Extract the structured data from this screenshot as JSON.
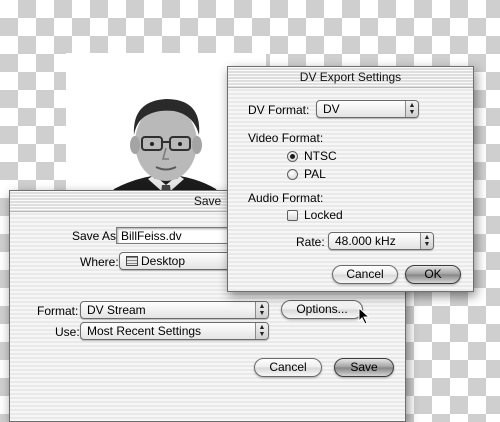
{
  "save_dialog": {
    "title": "Save",
    "save_as_label": "Save As:",
    "save_as_value": "BillFeiss.dv",
    "where_label": "Where:",
    "where_value": "Desktop",
    "where_icon": "desktop-folder-icon",
    "format_label": "Format:",
    "format_value": "DV Stream",
    "options_button": "Options...",
    "use_label": "Use:",
    "use_value": "Most Recent Settings",
    "cancel_button": "Cancel",
    "save_button": "Save"
  },
  "dv_dialog": {
    "title": "DV Export Settings",
    "dv_format_label": "DV Format:",
    "dv_format_value": "DV",
    "video_format_label": "Video Format:",
    "video_options": [
      {
        "label": "NTSC",
        "selected": true
      },
      {
        "label": "PAL",
        "selected": false
      }
    ],
    "audio_format_label": "Audio Format:",
    "locked_label": "Locked",
    "locked_checked": false,
    "rate_label": "Rate:",
    "rate_value": "48.000 kHz",
    "cancel_button": "Cancel",
    "ok_button": "OK"
  },
  "background": {
    "photo": "portrait-photo-grayscale"
  },
  "colors": {
    "checker_light": "#ffffff",
    "checker_dark": "#cfcfcf"
  }
}
